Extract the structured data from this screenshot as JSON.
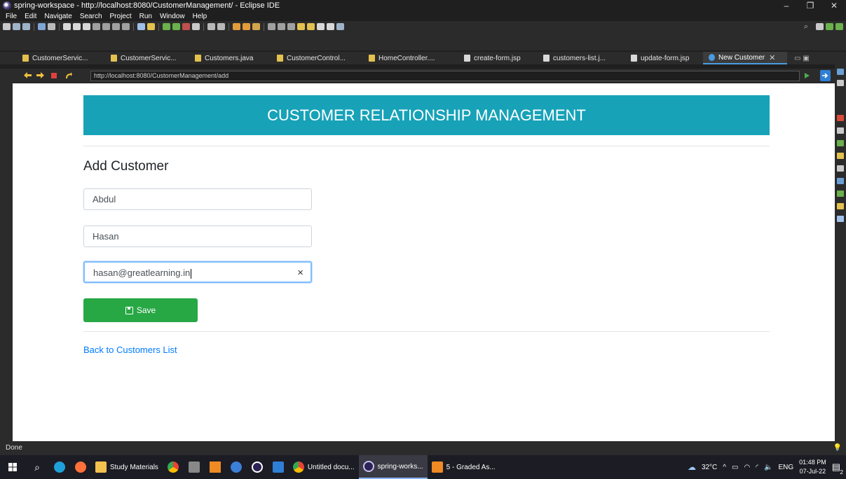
{
  "window": {
    "title": "spring-workspace - http://localhost:8080/CustomerManagement/ - Eclipse IDE",
    "minimize": "–",
    "maximize": "❐",
    "close": "✕"
  },
  "menu": [
    "File",
    "Edit",
    "Navigate",
    "Search",
    "Project",
    "Run",
    "Window",
    "Help"
  ],
  "tabs": [
    {
      "label": "CustomerServic...",
      "icon": "java-file-icon"
    },
    {
      "label": "CustomerServic...",
      "icon": "java-file-icon"
    },
    {
      "label": "Customers.java",
      "icon": "java-file-icon"
    },
    {
      "label": "CustomerControl...",
      "icon": "java-file-icon"
    },
    {
      "label": "HomeController....",
      "icon": "java-file-icon"
    },
    {
      "label": "create-form.jsp",
      "icon": "jsp-file-icon"
    },
    {
      "label": "customers-list.j...",
      "icon": "jsp-file-icon"
    },
    {
      "label": "update-form.jsp",
      "icon": "jsp-file-icon"
    },
    {
      "label": "New Customer",
      "icon": "globe-icon",
      "active": true
    }
  ],
  "browser": {
    "url": "http://localhost:8080/CustomerManagement/add"
  },
  "page": {
    "banner": "CUSTOMER RELATIONSHIP MANAGEMENT",
    "heading": "Add Customer",
    "first_name": "Abdul",
    "last_name": "Hasan",
    "email": "hasan@greatlearning.in",
    "clear_symbol": "×",
    "save_label": "Save",
    "back_link": "Back to Customers List"
  },
  "status": {
    "text": "Done"
  },
  "taskbar": {
    "apps": [
      {
        "label": "Study Materials",
        "icon": "folder-icon"
      },
      {
        "label": "Untitled docu...",
        "icon": "chrome-icon"
      },
      {
        "label": "spring-works...",
        "icon": "eclipse-icon",
        "active": true
      },
      {
        "label": "5 - Graded As...",
        "icon": "g-app-icon"
      }
    ],
    "weather": "32°C",
    "language": "ENG",
    "time": "01:48 PM",
    "date": "07-Jul-22",
    "notification_count": "2"
  },
  "colors": {
    "banner": "#17a2b8",
    "save": "#28a745",
    "link": "#007bff"
  }
}
